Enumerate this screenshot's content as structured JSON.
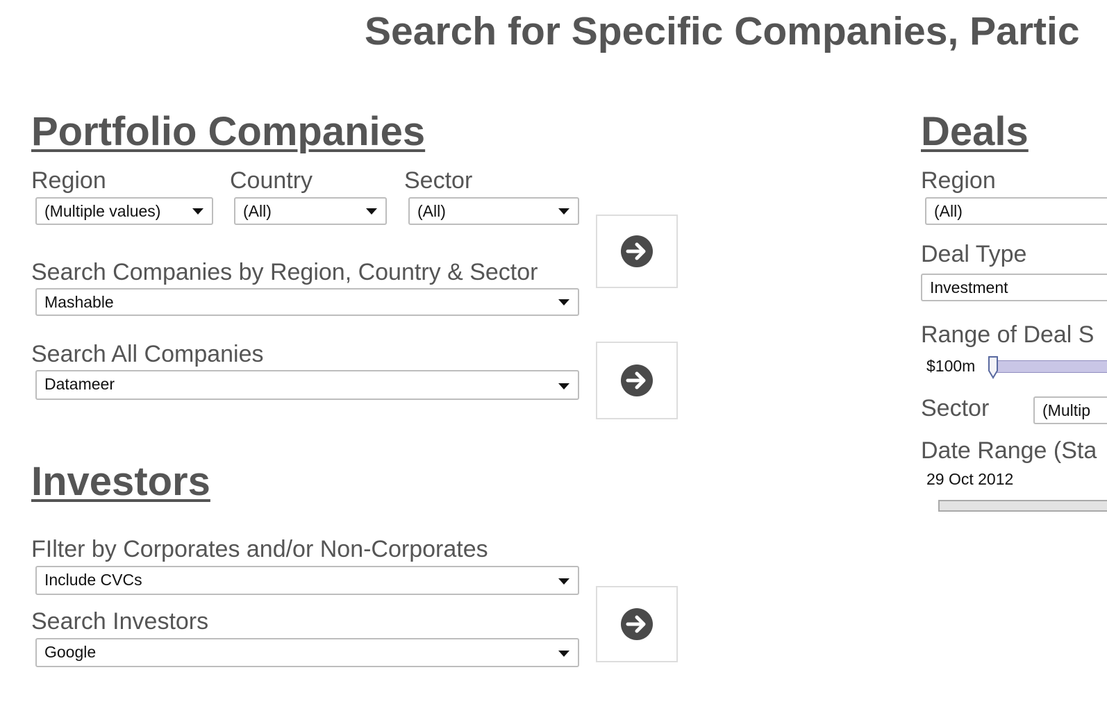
{
  "page": {
    "title": "Search for Specific Companies, Partic"
  },
  "portfolio": {
    "heading": "Portfolio Companies",
    "region": {
      "label": "Region",
      "value": "(Multiple values)"
    },
    "country": {
      "label": "Country",
      "value": "(All)"
    },
    "sector": {
      "label": "Sector",
      "value": "(All)"
    },
    "search_by": {
      "label": "Search Companies by Region, Country & Sector",
      "value": "Mashable"
    },
    "search_all": {
      "label": "Search All Companies",
      "value": "Datameer"
    }
  },
  "investors": {
    "heading": "Investors",
    "filter": {
      "label": "FIlter by Corporates and/or Non-Corporates",
      "value": "Include CVCs"
    },
    "search": {
      "label": "Search Investors",
      "value": "Google"
    }
  },
  "deals": {
    "heading": "Deals",
    "region": {
      "label": "Region",
      "value": "(All)"
    },
    "deal_type": {
      "label": "Deal Type",
      "value": "Investment"
    },
    "range": {
      "label": "Range of Deal S",
      "min_value": "$100m"
    },
    "sector": {
      "label": "Sector",
      "value": "(Multip"
    },
    "date_range": {
      "label": "Date Range (Sta",
      "start_value": "29 Oct 2012"
    }
  },
  "icons": {
    "go": "arrow-right-circle-icon",
    "dropdown": "caret-down-icon"
  },
  "colors": {
    "text": "#555555",
    "button_icon": "#4a4a4a",
    "slider_fill": "#c9c6e6",
    "slider_border": "#5a6aa0"
  }
}
